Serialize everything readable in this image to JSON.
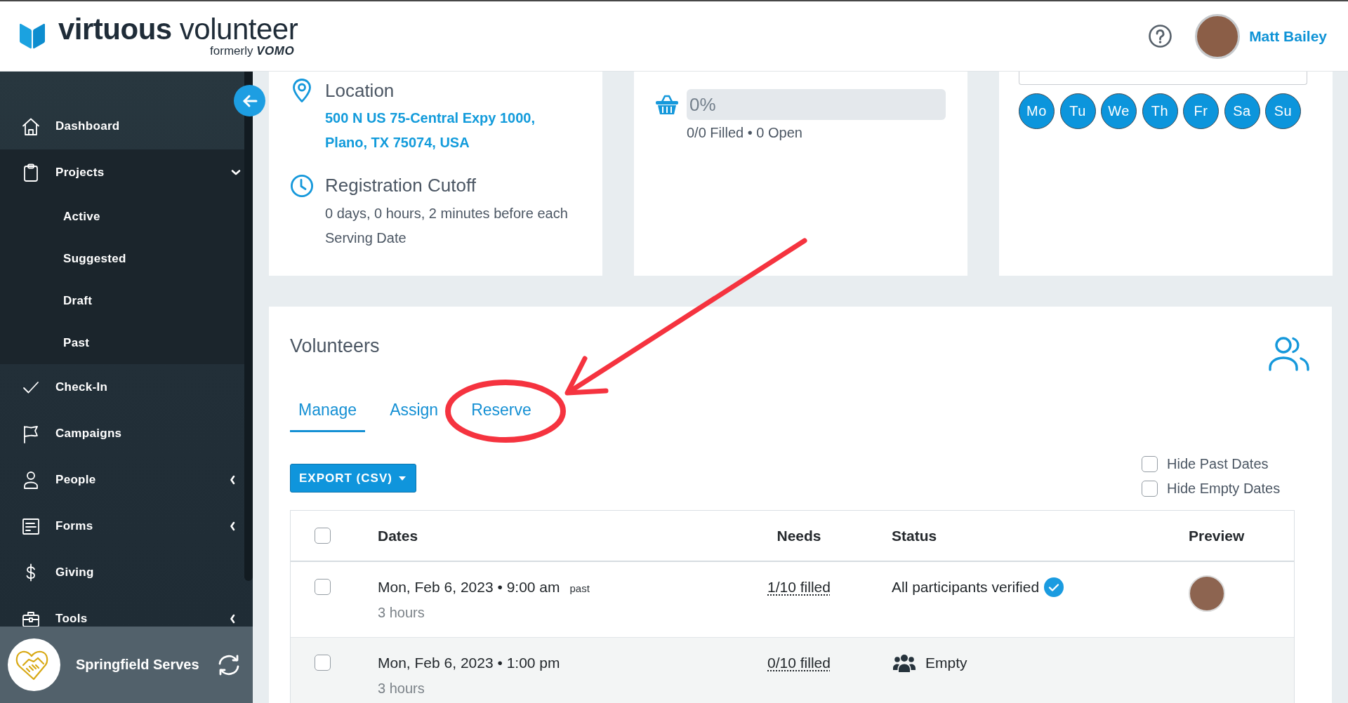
{
  "header": {
    "logo": {
      "wordmark": "**virtuous** volunteer",
      "tagline": "formerly **VOMO**"
    },
    "user": {
      "name": "Matt Bailey"
    }
  },
  "sidebar": {
    "items": [
      {
        "kind": "link",
        "label": "Dashboard"
      },
      {
        "kind": "group",
        "label": "Projects",
        "expanded": true,
        "children": [
          {
            "label": "Active"
          },
          {
            "label": "Suggested"
          },
          {
            "label": "Draft"
          },
          {
            "label": "Past"
          }
        ]
      },
      {
        "kind": "link",
        "label": "Check-In"
      },
      {
        "kind": "link",
        "label": "Campaigns"
      },
      {
        "kind": "group",
        "label": "People",
        "expanded": false
      },
      {
        "kind": "group",
        "label": "Forms",
        "expanded": false
      },
      {
        "kind": "link",
        "label": "Giving"
      },
      {
        "kind": "group",
        "label": "Tools",
        "expanded": false
      }
    ],
    "organization": {
      "name": "Springfield Serves"
    }
  },
  "location_card": {
    "title": "Location",
    "address": "500 N US 75-Central Expy 1000, Plano, TX 75074, USA",
    "cutoff_title": "Registration Cutoff",
    "cutoff_text": "0 days, 0 hours, 2 minutes before each Serving Date"
  },
  "capacity_card": {
    "progress": {
      "label": "0%",
      "level": 0
    },
    "summary": "0/0 Filled • 0 Open"
  },
  "schedule_card": {
    "days": [
      {
        "label": "Mo",
        "selected": true
      },
      {
        "label": "Tu",
        "selected": true
      },
      {
        "label": "We",
        "selected": true
      },
      {
        "label": "Th",
        "selected": true
      },
      {
        "label": "Fr",
        "selected": true
      },
      {
        "label": "Sa",
        "selected": true
      },
      {
        "label": "Su",
        "selected": true
      }
    ]
  },
  "volunteers": {
    "title": "Volunteers",
    "tabs": [
      {
        "label": "Manage",
        "selected": true
      },
      {
        "label": "Assign",
        "selected": false
      },
      {
        "label": "Reserve",
        "selected": false
      }
    ],
    "export_button": {
      "label": "EXPORT (CSV)"
    },
    "filters": [
      {
        "label": "Hide Past Dates",
        "checked": false
      },
      {
        "label": "Hide Empty Dates",
        "checked": false
      }
    ],
    "table": {
      "columns": [
        "Dates",
        "Needs",
        "Status",
        "Preview"
      ],
      "all_checked": false,
      "rows": [
        {
          "checked": false,
          "date": "Mon, Feb 6, 2023 • 9:00 am",
          "tag": "past",
          "duration": "3 hours",
          "needs": "1/10 filled",
          "status": {
            "kind": "verified",
            "text": "All participants verified"
          },
          "preview_photo": true
        },
        {
          "checked": false,
          "date": "Mon, Feb 6, 2023 • 1:00 pm",
          "duration": "3 hours",
          "needs": "0/10 filled",
          "status": {
            "kind": "empty",
            "text": "Empty"
          },
          "preview_photo": false
        }
      ]
    }
  }
}
